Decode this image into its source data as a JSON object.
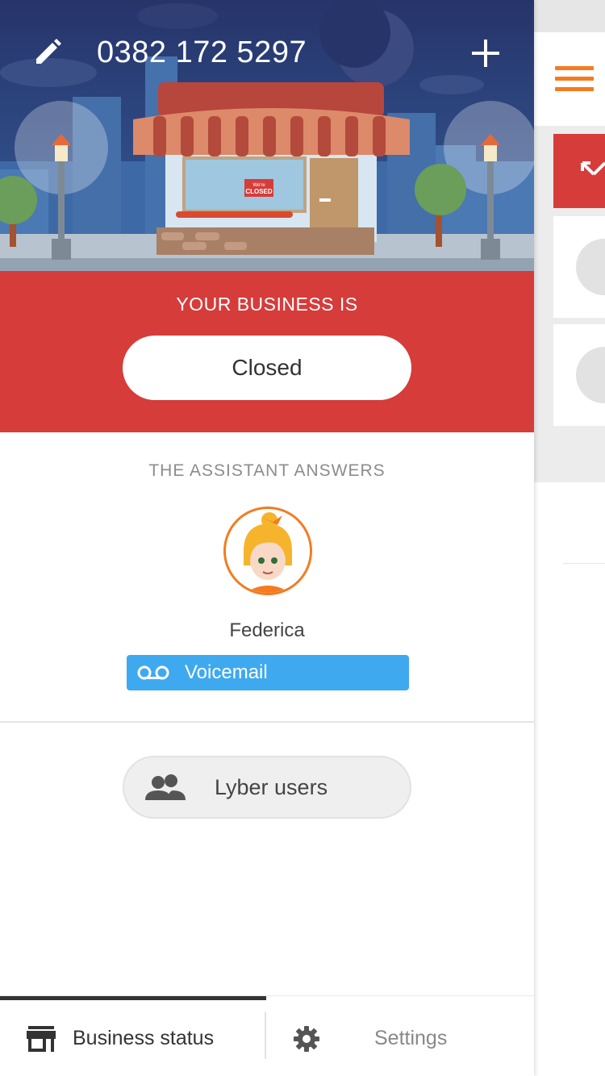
{
  "header": {
    "phone_number": "0382 172 5297",
    "edit_icon": "pencil-icon",
    "add_icon": "plus-icon",
    "shop_sign": "We're CLOSED"
  },
  "status": {
    "label": "YOUR BUSINESS IS",
    "value": "Closed",
    "band_color": "#d63c3a"
  },
  "assistant": {
    "section_label": "THE ASSISTANT ANSWERS",
    "name": "Federica",
    "mode_icon": "voicemail-icon",
    "mode_label": "Voicemail",
    "mode_color": "#3fa9f0",
    "accent_color": "#f47b20"
  },
  "users": {
    "icon": "users-icon",
    "label": "Lyber users"
  },
  "tabs": {
    "business_status": {
      "icon": "store-icon",
      "label": "Business status",
      "active": true
    },
    "settings": {
      "icon": "gear-icon",
      "label": "Settings",
      "active": false
    }
  },
  "background_panel": {
    "menu_icon": "hamburger-icon",
    "accent_color": "#f47b20"
  }
}
